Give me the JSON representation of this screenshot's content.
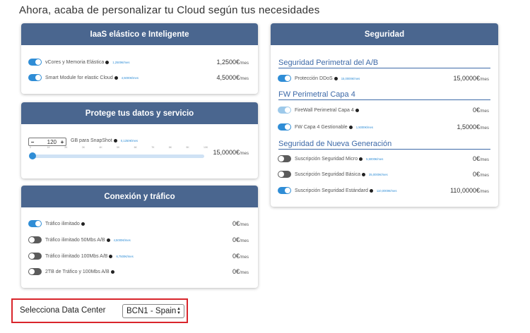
{
  "page_title": "Ahora, acaba de personalizar tu Cloud según tus necesidades",
  "iaas": {
    "title": "IaaS elástico e Inteligente",
    "rows": [
      {
        "label": "vCores y Memoria Elástica",
        "unit": "1,2500€/mes",
        "price": "1,2500€",
        "per": "/mes",
        "state": "on"
      },
      {
        "label": "Smart Module for elastic Cloud",
        "unit": "4,5000€/mes",
        "price": "4,5000€",
        "per": "/mes",
        "state": "on"
      }
    ]
  },
  "backup": {
    "title": "Protege tus datos y servicio",
    "stepper_value": "120",
    "stepper_minus": "−",
    "stepper_plus": "+",
    "label": "GB para SnapShot",
    "unit": "0,1250€/mes",
    "ticks": [
      "0",
      "1K",
      "2K",
      "3K",
      "4K",
      "5K",
      "6K",
      "7K",
      "8K",
      "9K",
      "10K"
    ],
    "slider_fraction": 0.012,
    "price": "15,0000€",
    "per": "/mes"
  },
  "traffic": {
    "title": "Conexión y tráfico",
    "rows": [
      {
        "label": "Tráfico ilimitado",
        "unit": "",
        "price": "0€",
        "per": "/mes",
        "state": "on"
      },
      {
        "label": "Tráfico ilimitado 50Mbs A/B",
        "unit": "4,5000€/mes",
        "price": "0€",
        "per": "/mes",
        "state": "off"
      },
      {
        "label": "Tráfico ilimitado 100Mbs A/B",
        "unit": "6,7500€/mes",
        "price": "0€",
        "per": "/mes",
        "state": "off"
      },
      {
        "label": "2TB de Tráfico y 100Mbs A/B",
        "unit": "",
        "price": "0€",
        "per": "/mes",
        "state": "off"
      }
    ]
  },
  "security": {
    "title": "Seguridad",
    "perimetral": {
      "title": "Seguridad Perimetral del A/B",
      "rows": [
        {
          "label": "Protección DDoS",
          "unit": "15,0000€/mes",
          "price": "15,0000€",
          "per": "/mes",
          "state": "on"
        }
      ]
    },
    "fw": {
      "title": "FW Perimetral Capa 4",
      "rows": [
        {
          "label": "FireWall Perimetral Capa 4",
          "unit": "",
          "price": "0€",
          "per": "/mes",
          "state": "disabled"
        },
        {
          "label": "FW Capa 4 Gestionable",
          "unit": "1,5000€/mes",
          "price": "1,5000€",
          "per": "/mes",
          "state": "on"
        }
      ]
    },
    "newgen": {
      "title": "Seguridad de Nueva Generación",
      "rows": [
        {
          "label": "Suscripción Seguridad Micro",
          "unit": "5,5000€/mes",
          "price": "0€",
          "per": "/mes",
          "state": "off"
        },
        {
          "label": "Suscripción Seguridad Básica",
          "unit": "35,0000€/mes",
          "price": "0€",
          "per": "/mes",
          "state": "off"
        },
        {
          "label": "Suscripción Seguridad Estándard",
          "unit": "110,0000€/mes",
          "price": "110,0000€",
          "per": "/mes",
          "state": "on"
        }
      ]
    }
  },
  "datacenter": {
    "label": "Selecciona Data Center",
    "selected": "BCN1 - Spain"
  },
  "colors": {
    "card_header": "#4a668f",
    "toggle_on": "#2f8dd6",
    "highlight_border": "#d9252b",
    "subsection_title": "#3e6aa8"
  }
}
